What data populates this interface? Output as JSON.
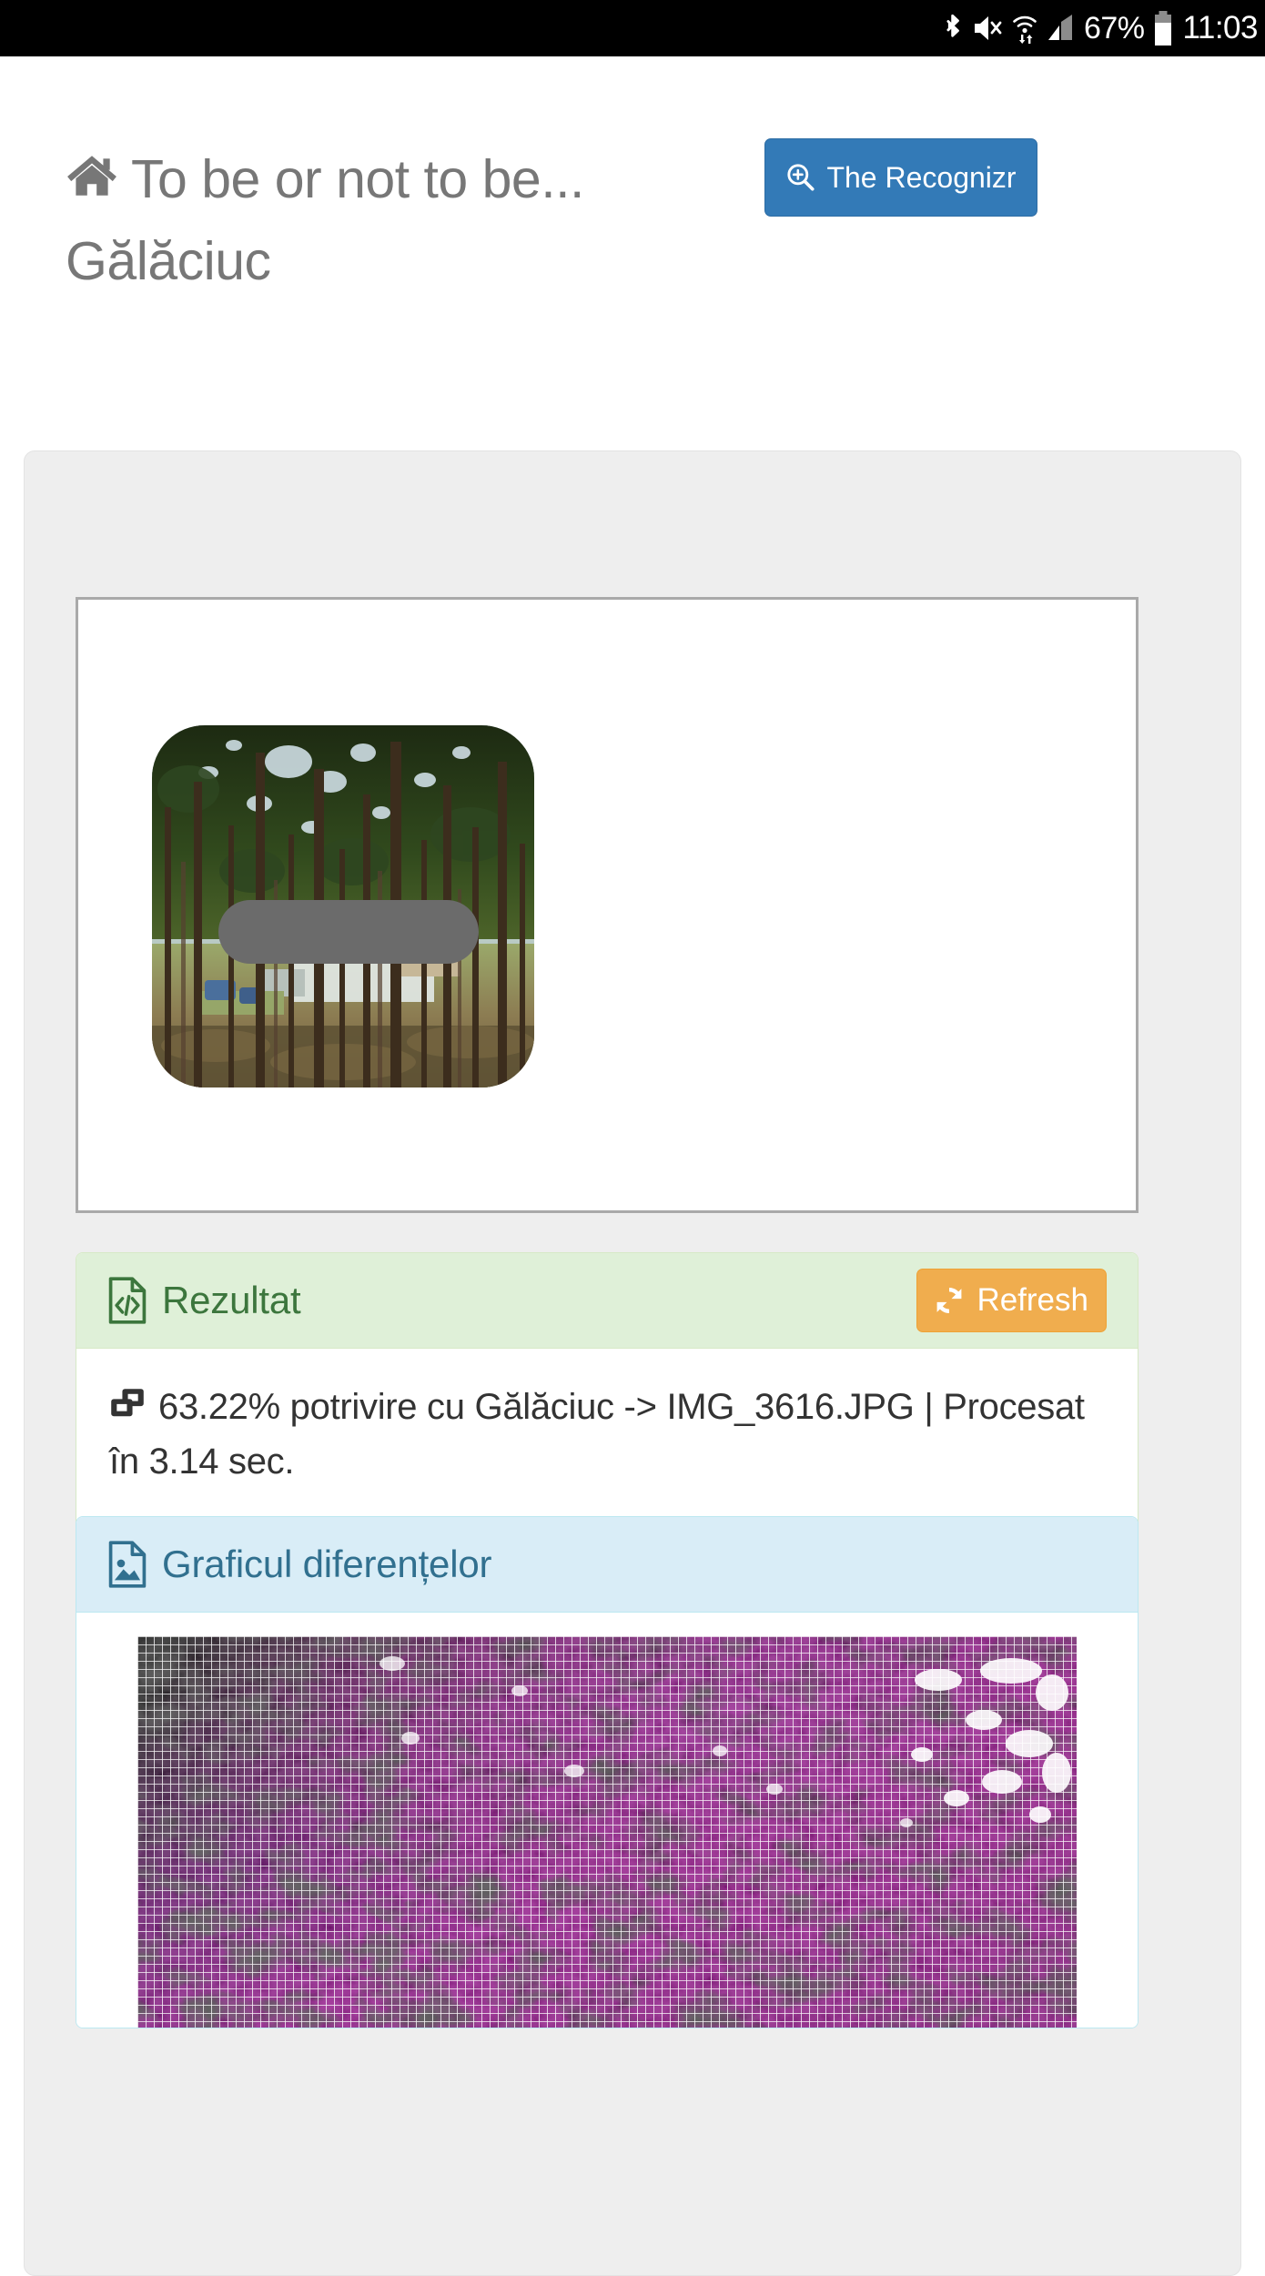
{
  "statusbar": {
    "icons": [
      "bluetooth-icon",
      "mute-icon",
      "wifi-icon",
      "signal-icon"
    ],
    "battery_percent": "67%",
    "battery_icon": "battery-icon",
    "clock": "11:03"
  },
  "header": {
    "home_icon": "home-icon",
    "title": "To be or not to be... Gălăciuc",
    "recognizr_button": {
      "label": "The Recognizr",
      "icon": "search-plus-icon",
      "color": "#337ab7"
    }
  },
  "preview": {
    "image_alt": "forest-photo-thumbnail",
    "overlay": "redaction-bar"
  },
  "result_panel": {
    "icon": "file-code-icon",
    "title": "Rezultat",
    "refresh_button": {
      "label": "Refresh",
      "icon": "refresh-icon",
      "color": "#f0ad4e"
    },
    "body_icon": "clone-icon",
    "body_text": "63.22% potrivire cu Gălăciuc -> IMG_3616.JPG | Procesat în 3.14 sec.",
    "match_percent": "63.22%",
    "matched_file": "IMG_3616.JPG",
    "matched_label": "Gălăciuc",
    "processing_time": "3.14 sec.",
    "header_color": "#dff0d8",
    "text_color": "#3c763d"
  },
  "graph_panel": {
    "icon": "file-image-icon",
    "title": "Graficul diferențelor",
    "header_color": "#d9edf7",
    "text_color": "#31708f",
    "graph_alt": "difference-heatmap-magenta"
  }
}
